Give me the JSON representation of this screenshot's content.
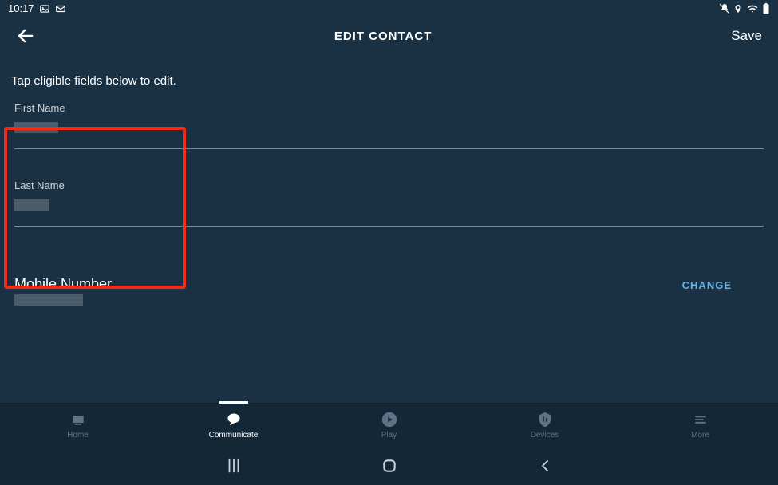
{
  "status_bar": {
    "time": "10:17"
  },
  "header": {
    "title": "EDIT CONTACT",
    "save_label": "Save"
  },
  "instruction": "Tap eligible fields below to edit.",
  "fields": {
    "first_name": {
      "label": "First Name"
    },
    "last_name": {
      "label": "Last Name"
    }
  },
  "mobile": {
    "label": "Mobile Number",
    "change_label": "CHANGE"
  },
  "nav": {
    "home": "Home",
    "communicate": "Communicate",
    "play": "Play",
    "devices": "Devices",
    "more": "More"
  }
}
